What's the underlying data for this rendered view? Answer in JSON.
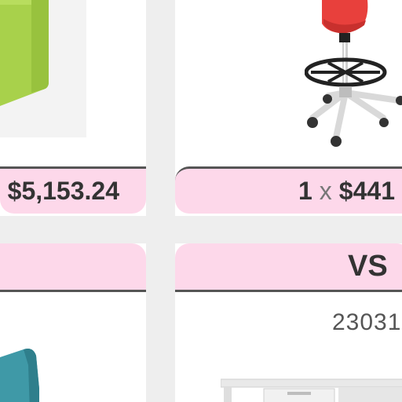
{
  "products": [
    {
      "price_text": "$5,153.24"
    },
    {
      "quantity": "1",
      "times_symbol": "x",
      "price_text": "$441"
    }
  ],
  "compare": {
    "vs_label": "VS",
    "code_text": "23031"
  },
  "icons": {
    "green_product": "green-panel-product-icon",
    "chair_product": "red-stool-chair-icon",
    "teal_product": "teal-seat-product-icon",
    "desk_product": "white-desk-product-icon"
  },
  "colors": {
    "price_band": "#fdd8ea",
    "divider": "#555555",
    "page_background": "#eeeeee",
    "card_background": "#ffffff"
  }
}
